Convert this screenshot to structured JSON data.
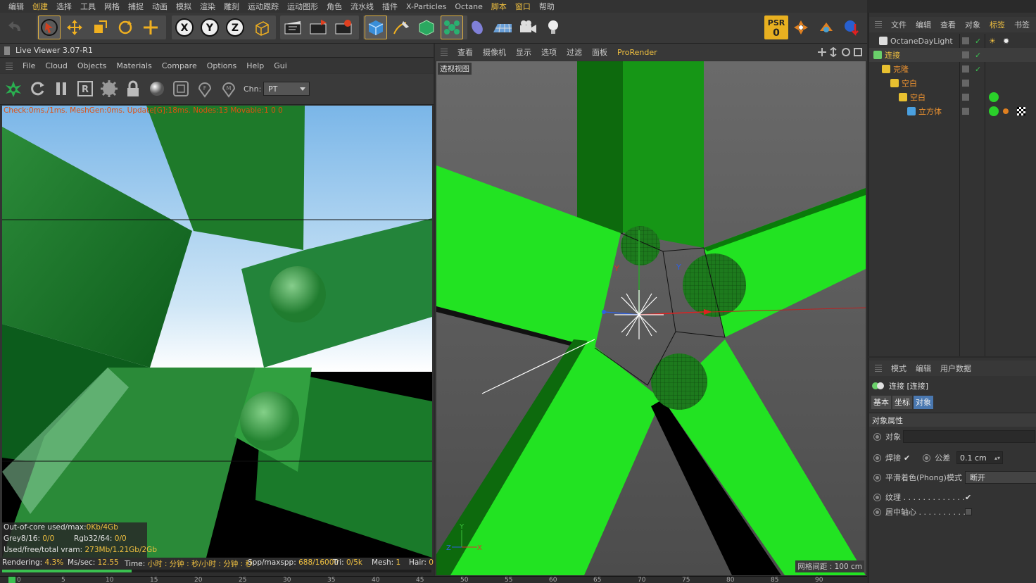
{
  "menubar": {
    "items": [
      "编辑",
      "创建",
      "选择",
      "工具",
      "网格",
      "捕捉",
      "动画",
      "模拟",
      "渲染",
      "雕刻",
      "运动跟踪",
      "运动图形",
      "角色",
      "流水线",
      "插件",
      "X-Particles",
      "Octane",
      "脚本",
      "窗口",
      "帮助"
    ]
  },
  "toolbar": {
    "axis_x": "X",
    "axis_y": "Y",
    "axis_z": "Z",
    "psr_label": "PSR",
    "psr_value": "0"
  },
  "live_viewer": {
    "title": "Live Viewer 3.07-R1",
    "menu": [
      "File",
      "Cloud",
      "Objects",
      "Materials",
      "Compare",
      "Options",
      "Help",
      "Gui"
    ],
    "channel_label": "Chn:",
    "channel_value": "PT",
    "info": "Check:0ms./1ms. MeshGen:0ms. Update[G]:18ms. Nodes:13 Movable:1  0 0",
    "stats": {
      "ooc_label": "Out-of-core used/max:",
      "ooc_value": "0Kb/4Gb",
      "grey_label": "Grey8/16:",
      "grey_value": "0/0",
      "rgb_label": "Rgb32/64:",
      "rgb_value": "0/0",
      "vram_label": "Used/free/total vram:",
      "vram_value": "273Mb/1.21Gb/2Gb"
    },
    "status": {
      "rendering_label": "Rendering:",
      "rendering_value": "4.3%",
      "ms_label": "Ms/sec:",
      "ms_value": "12.55",
      "time_label": "Time:",
      "time_value": "小时 : 分钟 : 秒/小时 : 分钟 : 秒",
      "spp_label": "Spp/maxspp:",
      "spp_value": "688/16000",
      "tri_label": "Tri:",
      "tri_value": "0/5k",
      "mesh_label": "Mesh:",
      "mesh_value": "1",
      "hair_label": "Hair:",
      "hair_value": "0"
    },
    "progress": 0.043
  },
  "viewport": {
    "menu": [
      "查看",
      "摄像机",
      "显示",
      "选项",
      "过滤",
      "面板",
      "ProRender"
    ],
    "view_label": "透视视图",
    "grid_label": "网格间距 : 100 cm",
    "axis_y": "Y",
    "axis_z": "Z",
    "axis_x": "X"
  },
  "object_manager": {
    "tabs": [
      "文件",
      "编辑",
      "查看",
      "对象",
      "标签",
      "书签"
    ],
    "rows": [
      {
        "name": "OctaneDayLight",
        "color": "#c8c8c8"
      },
      {
        "name": "连接",
        "color": "#f0c040"
      },
      {
        "name": "克隆",
        "color": "#e89030"
      },
      {
        "name": "空白",
        "color": "#e89030"
      },
      {
        "name": "空白",
        "color": "#e89030"
      },
      {
        "name": "立方体",
        "color": "#e89030"
      }
    ]
  },
  "attribute_manager": {
    "tabs": [
      "模式",
      "编辑",
      "用户数据"
    ],
    "object_title": "连接 [连接]",
    "subtabs": [
      "基本",
      "坐标",
      "对象"
    ],
    "section": "对象属性",
    "fields": {
      "object_label": "对象",
      "weld_label": "焊接",
      "tolerance_label": "公差",
      "tolerance_value": "0.1 cm",
      "phong_label": "平滑着色(Phong)模式",
      "phong_value": "断开",
      "texture_label": "纹理 . . . . . . . . . . . . .",
      "center_label": "居中轴心 . . . . . . . . . . ."
    }
  },
  "timeline": {
    "ticks": [
      "0",
      "5",
      "10",
      "15",
      "20",
      "25",
      "30",
      "35",
      "40",
      "45",
      "50",
      "55",
      "60",
      "65",
      "70",
      "75",
      "80",
      "85",
      "90"
    ]
  }
}
